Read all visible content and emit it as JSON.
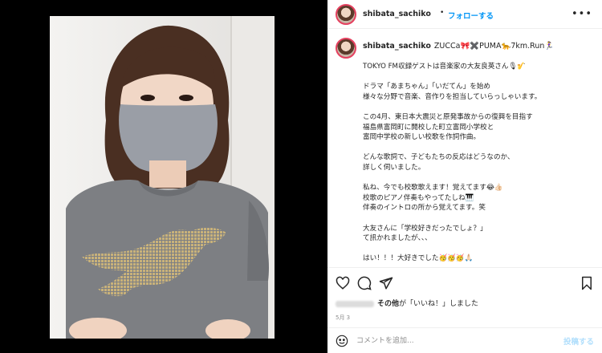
{
  "post": {
    "username": "shibata_sachiko",
    "follow_label": "フォローする",
    "dot": "•",
    "more_icon": "more-horizontal-icon"
  },
  "caption": {
    "username": "shibata_sachiko",
    "bio_inline": "ZUCCa🎀✖️PUMA🐆7km.Run🏃‍♀️",
    "lines": [
      "TOKYO FM収録ゲストは音楽家の大友良英さん🎙🎷",
      "",
      "ドラマ「あまちゃん」「いだてん」を始め",
      "様々な分野で音楽、音作りを担当していらっしゃいます。",
      "",
      "この4月、東日本大震災と原発事故からの復興を目指す",
      "福島県富岡町に開校した町立富岡小学校と",
      "富岡中学校の新しい校歌を作詞作曲。",
      "",
      "どんな歌詞で、子どもたちの反応はどうなのか、",
      "詳しく伺いました。",
      "",
      "私ね、今でも校歌歌えます！覚えてます😂👍🏻",
      "校歌のピアノ伴奏もやってたしね🎹",
      "伴奏のイントロの所から覚えてます。笑",
      "",
      "大友さんに「学校好きだったでしょ？」",
      "て訊かれましたが、、、",
      "",
      "はい！！！大好きでした🥳🥳🥳🙏🏻"
    ]
  },
  "actions": {
    "icons": [
      "heart-icon",
      "comment-icon",
      "share-icon",
      "bookmark-icon"
    ]
  },
  "likes": {
    "text_bold": "その他",
    "text_rest": "が「いいね！」しました"
  },
  "date": "5月 3",
  "comment": {
    "placeholder": "コメントを追加...",
    "post_label": "投稿する"
  },
  "colors": {
    "link_blue": "#0095f6",
    "post_disabled": "#b2dffc",
    "text": "#262626",
    "muted": "#8e8e8e"
  }
}
